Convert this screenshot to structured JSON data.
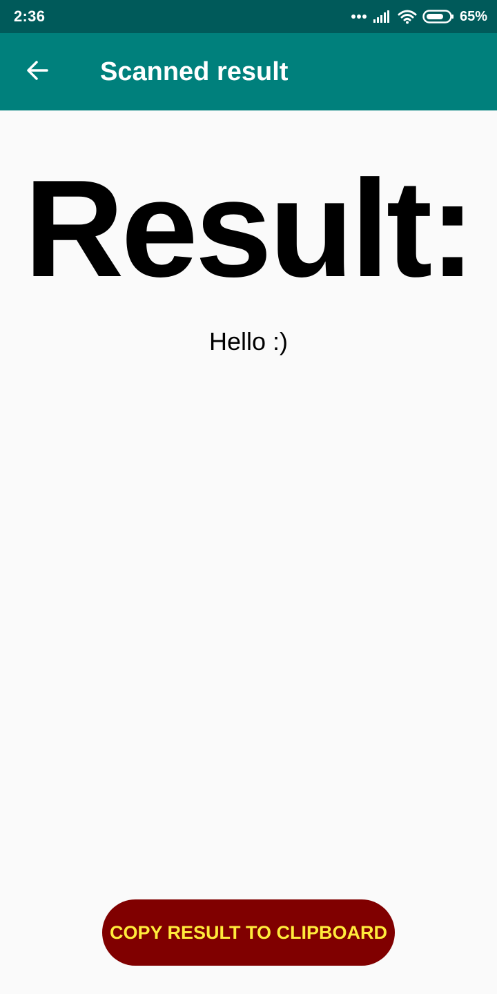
{
  "status_bar": {
    "time": "2:36",
    "battery_percent": "65%",
    "icons": [
      "dots-icon",
      "signal-icon",
      "wifi-icon",
      "battery-icon"
    ]
  },
  "app_bar": {
    "back_icon": "arrow-back-icon",
    "title": "Scanned result"
  },
  "main": {
    "heading": "Result:",
    "result_text": "Hello :)"
  },
  "actions": {
    "copy_label": "COPY RESULT TO CLIPBOARD"
  },
  "colors": {
    "status_bar": "#005a5a",
    "app_bar": "#00807c",
    "background": "#fafafa",
    "button_bg": "#800000",
    "button_text": "#ffeb3b"
  }
}
